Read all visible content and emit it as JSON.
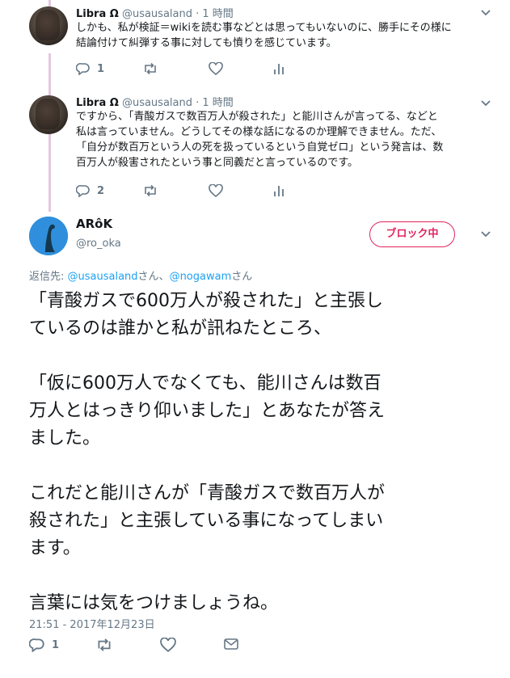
{
  "replies": [
    {
      "name": "Libra Ω",
      "handle": "@usausaland",
      "dot": "·",
      "time": "1 時間",
      "lines": [
        "しかも、私が検証＝wikiを読む事などとは思ってもいないのに、勝手にその様に",
        "結論付けて糾弾する事に対しても憤りを感じています。"
      ],
      "reply_count": "1"
    },
    {
      "name": "Libra Ω",
      "handle": "@usausaland",
      "dot": "·",
      "time": "1 時間",
      "lines": [
        "ですから、「青酸ガスで数百万人が殺された」と能川さんが言ってる、などと",
        "私は言っていません。どうしてその様な話になるのか理解できません。ただ、",
        "「自分が数百万という人の死を扱っているという自覚ゼロ」という発言は、数",
        "百万人が殺害されたという事と同義だと言っているのです。"
      ],
      "reply_count": "2"
    }
  ],
  "main": {
    "name": "ARôK",
    "handle": "@ro_oka",
    "block_label": "ブロック中",
    "replying_prefix": "返信先: ",
    "mention1": "@usausaland",
    "sep": "さん、",
    "mention2": "@nogawam",
    "suffix": "さん",
    "body_lines": [
      "「青酸ガスで600万人が殺された」と主張し",
      "ているのは誰かと私が訊ねたところ、",
      "",
      "「仮に600万人でなくても、能川さんは数百",
      "万人とはっきり仰いました」とあなたが答え",
      "ました。",
      "",
      "これだと能川さんが「青酸ガスで数百万人が",
      "殺された」と主張している事になってしまい",
      "ます。",
      "",
      "言葉には気をつけましょうね。"
    ],
    "timestamp": "21:51 - 2017年12月23日",
    "reply_count": "1"
  },
  "colors": {
    "text": "#14171a",
    "muted": "#657786",
    "link": "#1da1f2",
    "block": "#e0245e",
    "thread": "#e4c7dd"
  },
  "icons": [
    "reply-icon",
    "retweet-icon",
    "like-icon",
    "analytics-icon",
    "dm-icon",
    "chevron-down-icon"
  ]
}
